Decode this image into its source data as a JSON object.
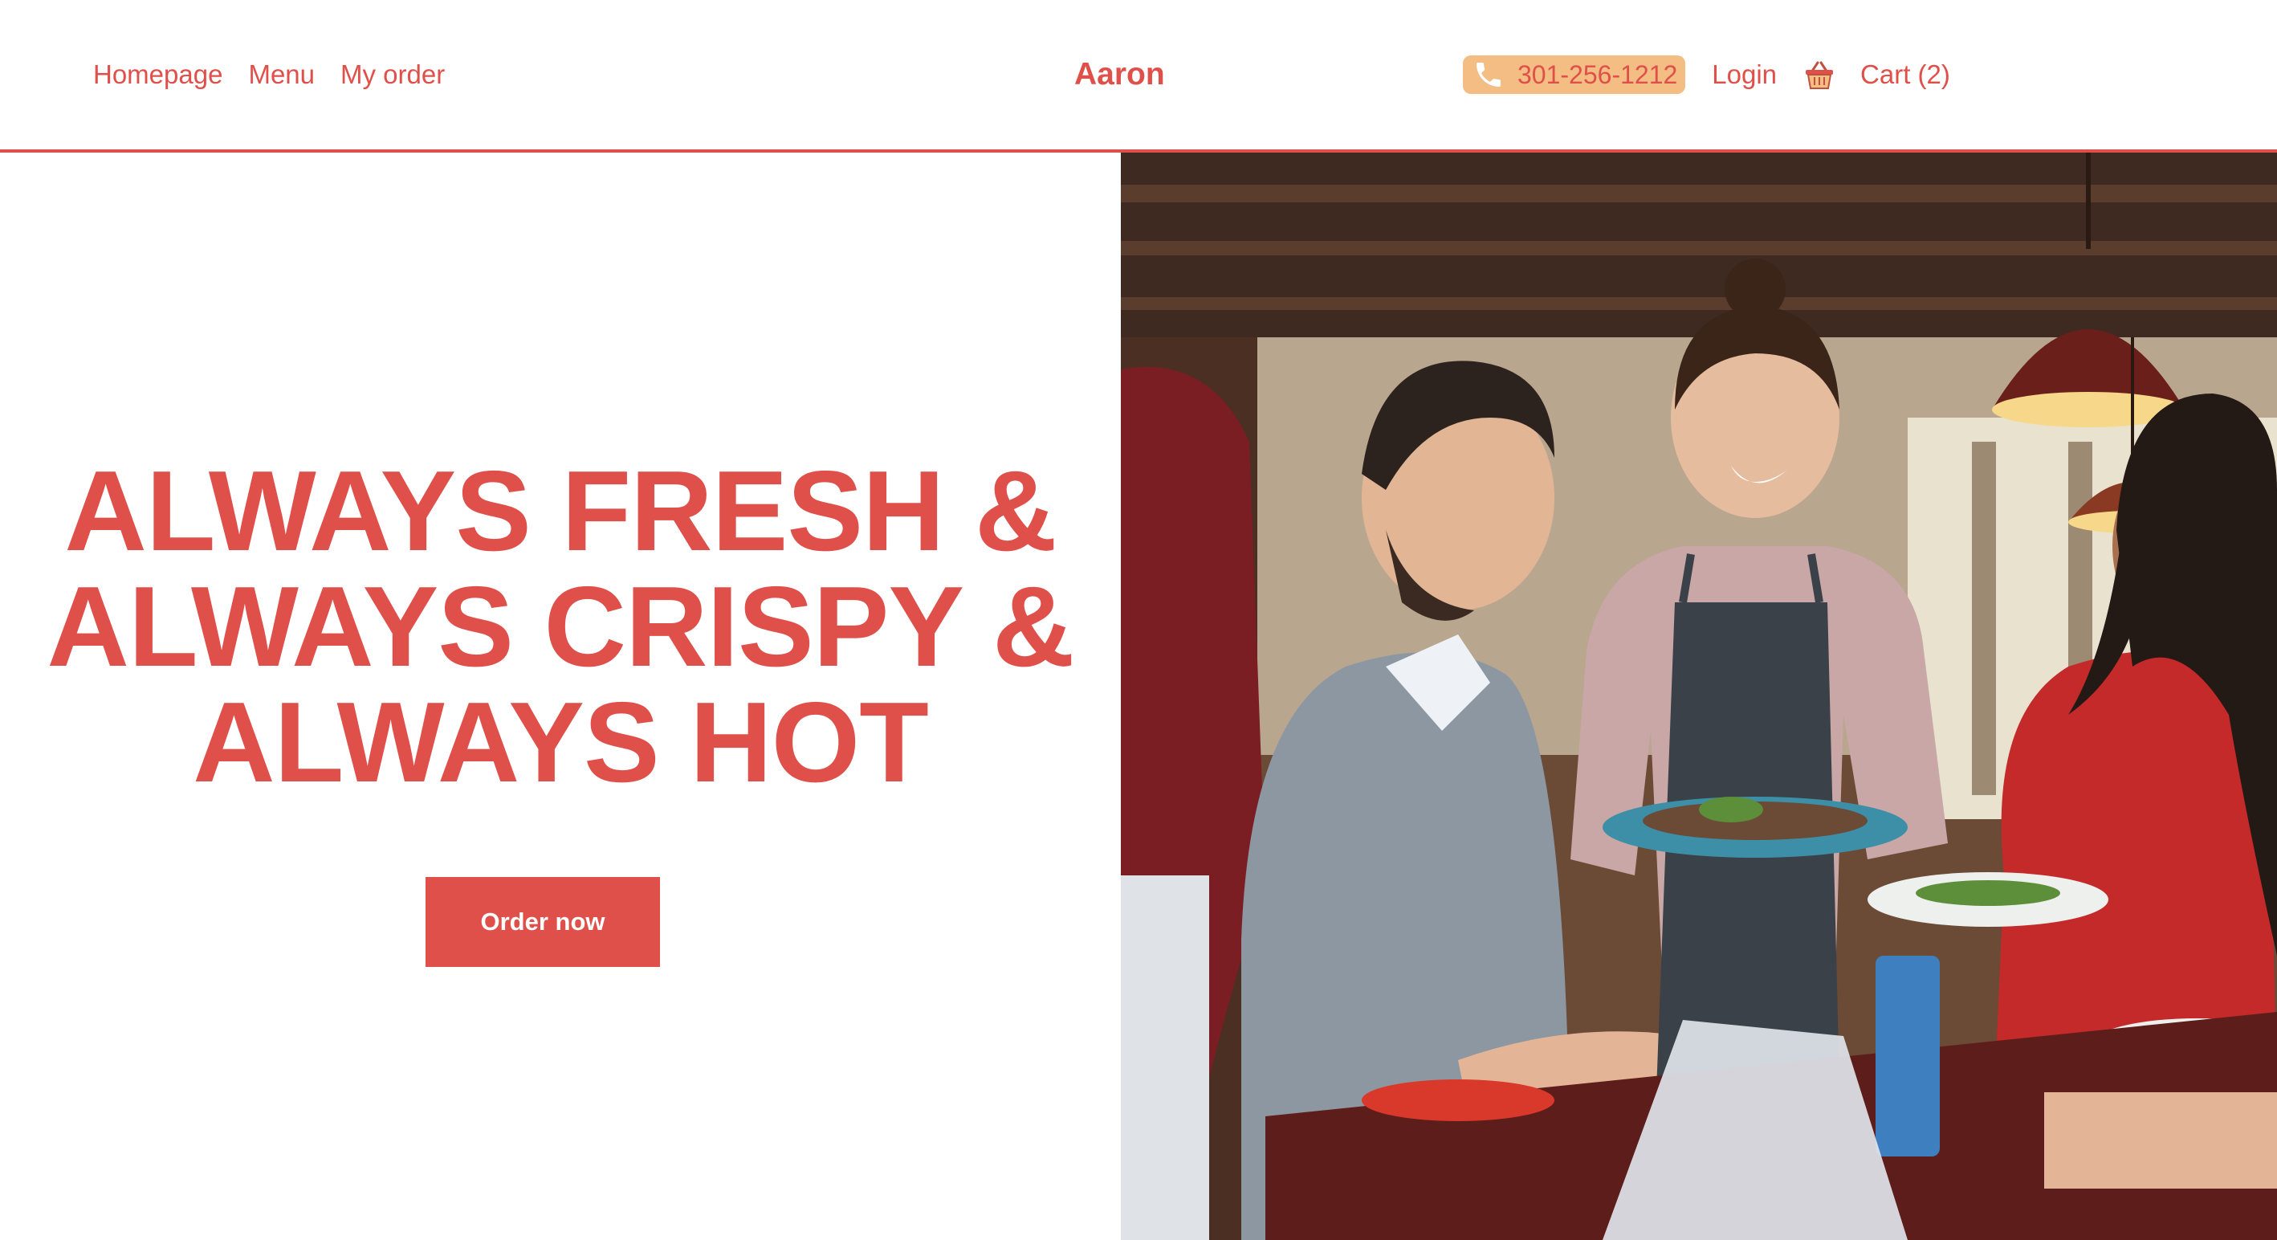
{
  "header": {
    "nav": {
      "homepage_label": "Homepage",
      "menu_label": "Menu",
      "my_order_label": "My order"
    },
    "brand": "Aaron",
    "phone": "301-256-1212",
    "login_label": "Login",
    "cart_label": "Cart (2)",
    "icons": {
      "phone": "phone-icon",
      "cart": "basket-icon"
    }
  },
  "hero": {
    "title_lines": [
      "ALWAYS FRESH &",
      "ALWAYS CRISPY &",
      "ALWAYS HOT"
    ],
    "cta_label": "Order now",
    "image_alt": "restaurant-waitress-serving-guests-photo"
  },
  "colors": {
    "accent": "#e0504b",
    "phone_badge": "#f3bd84",
    "background": "#ffffff"
  }
}
